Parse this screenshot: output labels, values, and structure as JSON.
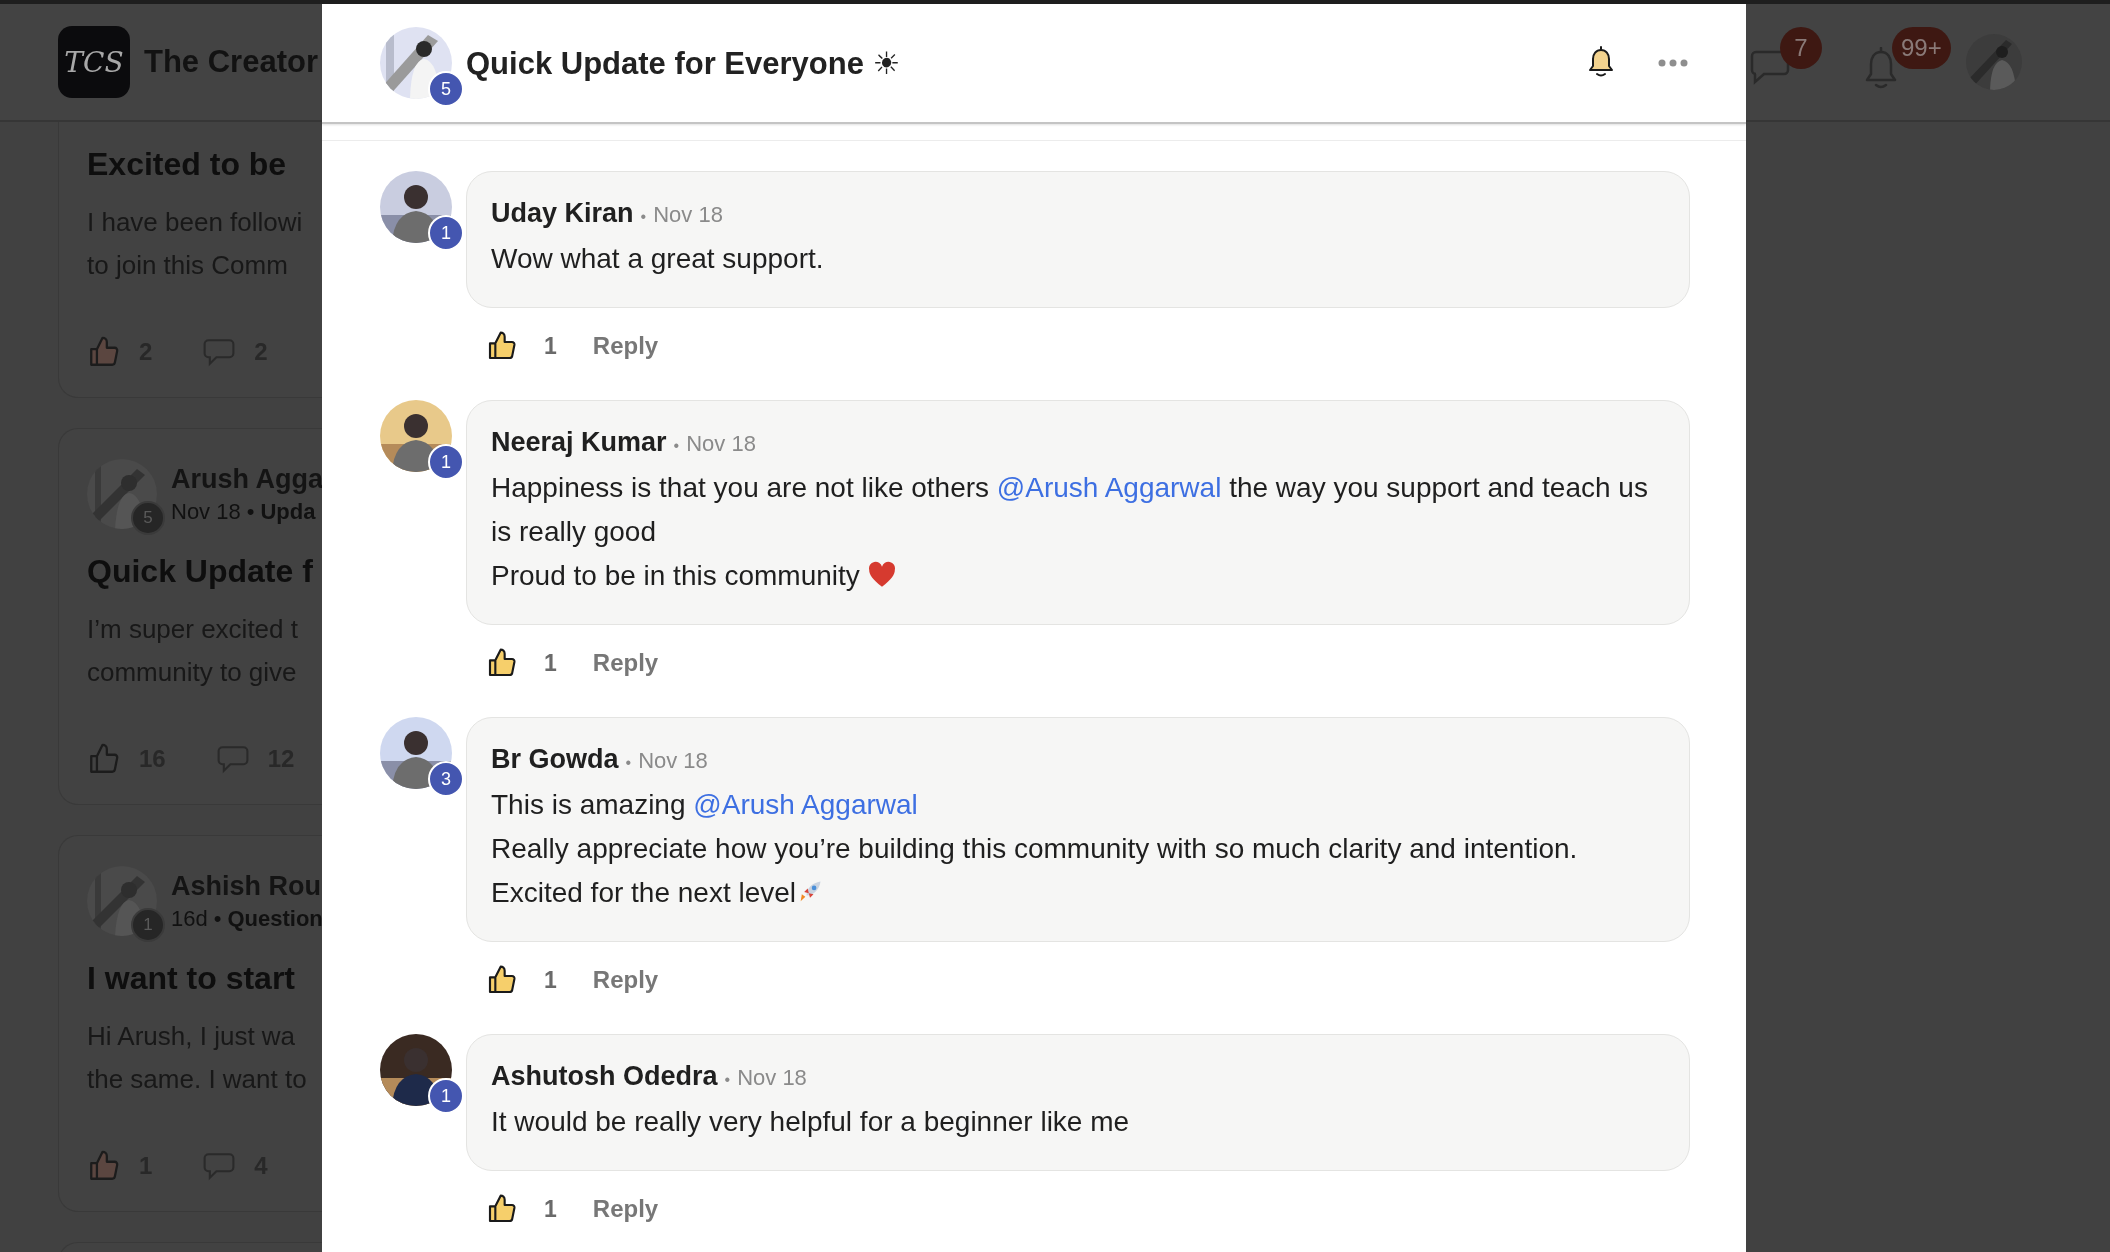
{
  "background": {
    "brand": {
      "logo": "TCS",
      "name": "The Creator"
    },
    "header_counts": [
      {
        "kind": "chat",
        "count": "7"
      },
      {
        "kind": "bell",
        "count": "99+"
      }
    ],
    "posts": [
      {
        "title": "Excited to be",
        "body": [
          "I have been followi",
          "to join this Comm"
        ],
        "likes": "2",
        "liked": true,
        "comments": "2"
      },
      {
        "author": "Arush Agga",
        "level": "5",
        "date": "Nov 18",
        "separator": "•",
        "category": "Upda",
        "title": "Quick Update f",
        "body": [
          "I’m super excited t",
          "community to give"
        ],
        "likes": "16",
        "liked": false,
        "comments": "12"
      },
      {
        "author": "Ashish Rou",
        "level": "1",
        "date": "16d",
        "separator": "•",
        "category": "Question",
        "title": "I want to start",
        "body": [
          "Hi Arush, I just wa",
          "the same. I want to"
        ],
        "likes": "1",
        "liked": true,
        "comments": "4"
      }
    ]
  },
  "post": {
    "title": "Quick Update for Everyone ☀",
    "author_level": "5"
  },
  "comments": [
    {
      "author": "Uday Kiran",
      "level": "1",
      "separator": "•",
      "date": "Nov 18",
      "paragraphs": [
        [
          {
            "kind": "text",
            "text": "Wow what a great support."
          }
        ]
      ],
      "likes": "1",
      "liked": true,
      "reply": "Reply"
    },
    {
      "author": "Neeraj Kumar",
      "level": "1",
      "separator": "•",
      "date": "Nov 18",
      "paragraphs": [
        [
          {
            "kind": "text",
            "text": "Happiness is that you are not like others "
          },
          {
            "kind": "mention",
            "text": "@Arush Aggarwal"
          },
          {
            "kind": "text",
            "text": " the way you support and teach us is really good"
          }
        ],
        [
          {
            "kind": "text",
            "text": "Proud to be in this community "
          },
          {
            "kind": "heart"
          }
        ]
      ],
      "likes": "1",
      "liked": true,
      "reply": "Reply"
    },
    {
      "author": "Br Gowda",
      "level": "3",
      "separator": "•",
      "date": "Nov 18",
      "paragraphs": [
        [
          {
            "kind": "text",
            "text": "This is amazing "
          },
          {
            "kind": "mention",
            "text": "@Arush Aggarwal"
          }
        ],
        [
          {
            "kind": "text",
            "text": "Really appreciate how you’re building this community with so much clarity and intention."
          }
        ],
        [
          {
            "kind": "text",
            "text": "Excited for the next level"
          },
          {
            "kind": "rocket"
          }
        ]
      ],
      "likes": "1",
      "liked": true,
      "reply": "Reply"
    },
    {
      "author": "Ashutosh Odedra",
      "level": "1",
      "separator": "•",
      "date": "Nov 18",
      "paragraphs": [
        [
          {
            "kind": "text",
            "text": "It would be really very helpful for a beginner like me"
          }
        ]
      ],
      "likes": "1",
      "liked": true,
      "reply": "Reply"
    }
  ]
}
